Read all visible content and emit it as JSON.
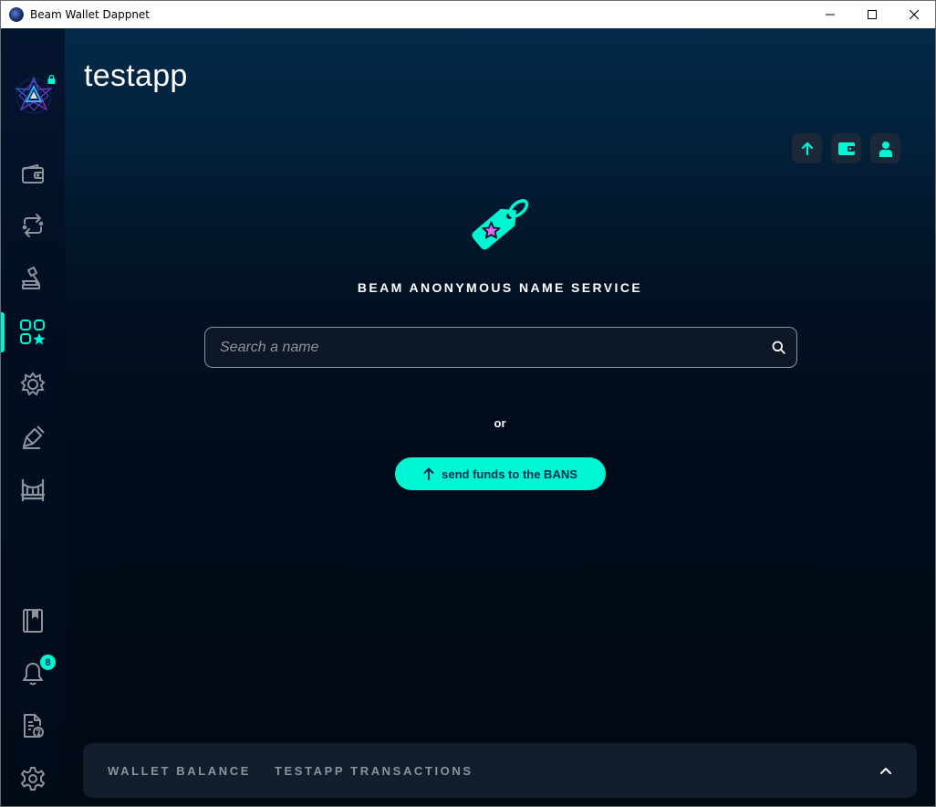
{
  "window": {
    "title": "Beam Wallet Dappnet",
    "controls": [
      "minimize-icon",
      "maximize-icon",
      "close-icon"
    ]
  },
  "sidebar": {
    "logo": "beam-logo",
    "items": [
      {
        "name": "wallet",
        "icon": "wallet-icon",
        "active": false
      },
      {
        "name": "atomic-swap",
        "icon": "swap-icon",
        "active": false
      },
      {
        "name": "dao",
        "icon": "gavel-icon",
        "active": false
      },
      {
        "name": "dapp-store",
        "icon": "apps-star-icon",
        "active": true
      },
      {
        "name": "faucet",
        "icon": "gear-star-icon",
        "active": false
      },
      {
        "name": "sign",
        "icon": "pen-icon",
        "active": false
      },
      {
        "name": "bridge",
        "icon": "bridge-icon",
        "active": false
      },
      {
        "name": "address-book",
        "icon": "book-icon",
        "active": false
      },
      {
        "name": "notifications",
        "icon": "bell-icon",
        "active": false
      },
      {
        "name": "documentation",
        "icon": "help-doc-icon",
        "active": false
      },
      {
        "name": "settings",
        "icon": "settings-icon",
        "active": false
      }
    ],
    "notification_count": "8"
  },
  "header": {
    "title": "testapp",
    "actions": [
      "send-arrow-icon",
      "wallet-icon",
      "user-icon"
    ]
  },
  "bans": {
    "logo": "star-tag-icon",
    "service_title": "BEAM ANONYMOUS NAME SERVICE",
    "search": {
      "placeholder": "Search a name",
      "value": ""
    },
    "or_label": "or",
    "send_button_label": "send funds to the BANS"
  },
  "bottom_panel": {
    "tabs": [
      "WALLET BALANCE",
      "TESTAPP TRANSACTIONS"
    ],
    "toggle_icon": "chevron-up-icon"
  },
  "colors": {
    "accent": "#00f6d2",
    "star": "#da68f5",
    "background": "#000a18"
  }
}
